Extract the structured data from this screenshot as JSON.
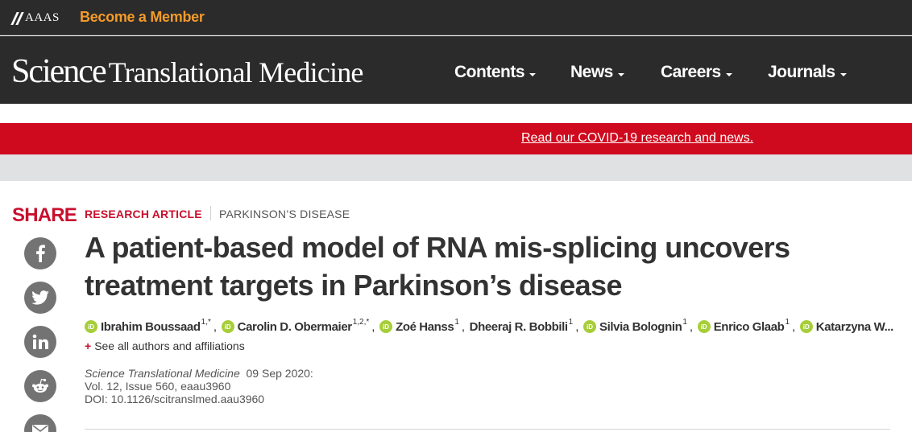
{
  "topbar": {
    "aaas_logo_text": "AAAS",
    "member_link": "Become a Member"
  },
  "header": {
    "brand_part1": "Science",
    "brand_part2": "Translational Medicine",
    "nav": [
      {
        "label": "Contents"
      },
      {
        "label": "News"
      },
      {
        "label": "Careers"
      },
      {
        "label": "Journals"
      }
    ]
  },
  "banner": {
    "covid_link": "Read our COVID-19 research and news."
  },
  "share": {
    "title": "SHARE",
    "buttons": [
      "facebook-icon",
      "twitter-icon",
      "linkedin-icon",
      "reddit-icon",
      "email-icon"
    ]
  },
  "article": {
    "type": "RESEARCH ARTICLE",
    "topic": "PARKINSON’S DISEASE",
    "title": "A patient-based model of RNA mis-splicing uncovers treatment targets in Parkinson’s disease",
    "authors": [
      {
        "name": "Ibrahim Boussaad",
        "sup": "1,*",
        "orcid": true
      },
      {
        "name": "Carolin D. Obermaier",
        "sup": "1,2,*",
        "orcid": true
      },
      {
        "name": "Zoé Hanss",
        "sup": "1",
        "orcid": true
      },
      {
        "name": "Dheeraj R. Bobbili",
        "sup": "1",
        "orcid": false
      },
      {
        "name": "Silvia Bolognin",
        "sup": "1",
        "orcid": true
      },
      {
        "name": "Enrico Glaab",
        "sup": "1",
        "orcid": true
      },
      {
        "name": "Katarzyna W...",
        "sup": "",
        "orcid": true
      }
    ],
    "orcid_label": "iD",
    "see_all": "See all authors and affiliations",
    "see_all_plus": "+",
    "citation": {
      "journal": "Science Translational Medicine",
      "date": "09 Sep 2020:",
      "volume": "Vol. 12, Issue 560, eaau3960",
      "doi": "DOI: 10.1126/scitranslmed.aau3960"
    }
  },
  "colors": {
    "header_bg": "#2b2b2b",
    "accent_orange": "#f39b2a",
    "brand_red": "#c8102e",
    "covid_red": "#cf0a1e",
    "orcid_green": "#a6ce39",
    "share_grey": "#737373"
  }
}
